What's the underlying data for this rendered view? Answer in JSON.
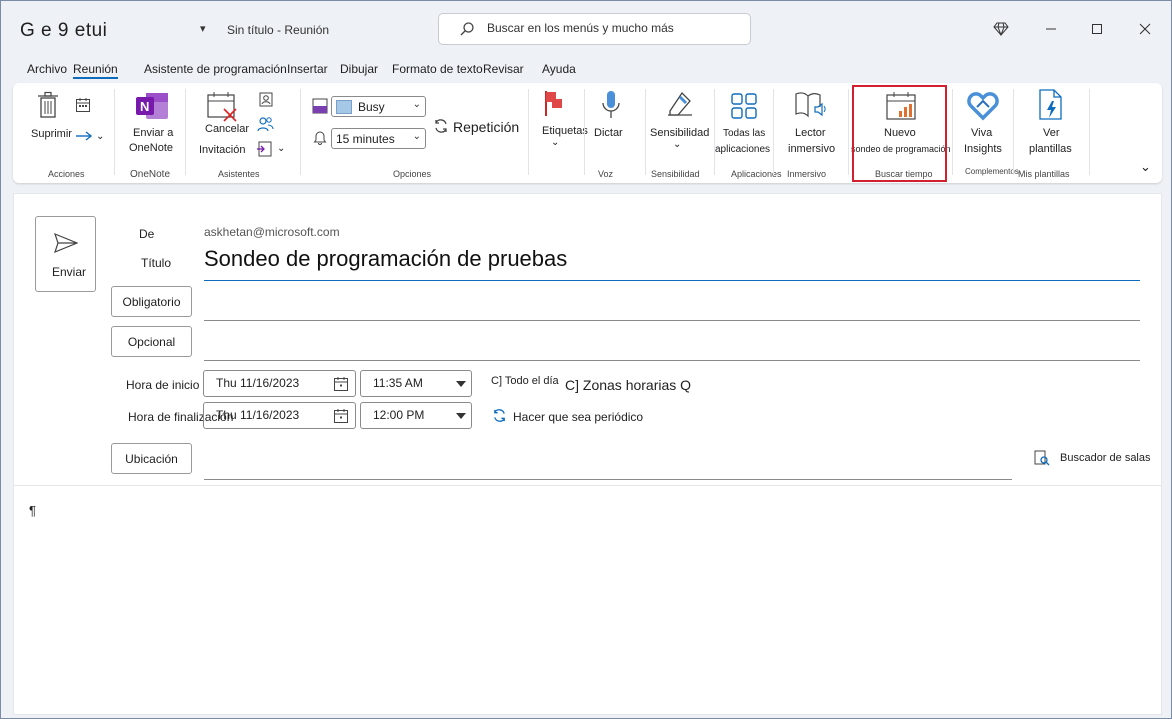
{
  "title_bar": {
    "app_title": "G e 9 etui",
    "quick_access_arrow": "▾",
    "doc_title": "Sin título  -  Reunión",
    "search_placeholder": "Buscar en los menús y mucho más"
  },
  "tabs": [
    {
      "label": "Archivo",
      "active": false
    },
    {
      "label": "Reunión",
      "active": true
    },
    {
      "label": "Asistente de programación",
      "active": false
    },
    {
      "label": "Insertar",
      "active": false
    },
    {
      "label": "Dibujar",
      "active": false
    },
    {
      "label": "Formato de texto",
      "active": false
    },
    {
      "label": "Revisar",
      "active": false
    },
    {
      "label": "Ayuda",
      "active": false
    }
  ],
  "ribbon": {
    "acciones": {
      "delete_label": "Suprimir",
      "group": "Acciones"
    },
    "onenote": {
      "line1": "Enviar a",
      "line2": "OneNote",
      "group": "OneNote"
    },
    "asistentes": {
      "cancel_label": "Cancelar",
      "invite_label": "Invitación",
      "group": "Asistentes"
    },
    "opciones": {
      "show_as": "Busy",
      "reminder": "15 minutes",
      "recurrence": "Repetición",
      "group": "Opciones"
    },
    "etiquetas": {
      "label": "Etiquetas"
    },
    "voz": {
      "label": "Dictar",
      "group": "Voz"
    },
    "sensibilidad": {
      "label": "Sensibilidad",
      "group": "Sensibilidad"
    },
    "aplicaciones": {
      "line1": "Todas las",
      "line2": "aplicaciones",
      "group": "Aplicaciones"
    },
    "inmersivo": {
      "line1": "Lector",
      "line2": "inmersivo",
      "group": "Inmersivo"
    },
    "buscar_tiempo": {
      "line1": "Nuevo",
      "line2": "sondeo de programación",
      "group": "Buscar tiempo"
    },
    "complementos": {
      "line1": "Viva",
      "line2": "Insights",
      "group": "Complementos"
    },
    "plantillas": {
      "line1": "Ver",
      "line2": "plantillas",
      "group": "Mis plantillas"
    }
  },
  "form": {
    "send_label": "Enviar",
    "from_label": "De",
    "from_value": "askhetan@microsoft.com",
    "title_label": "Título",
    "title_value": "Sondeo de programación de pruebas",
    "required_button": "Obligatorio",
    "optional_button": "Opcional",
    "start_label": "Hora de inicio",
    "start_date": "Thu 11/16/2023",
    "start_time": "11:35 AM",
    "allday_label": "C] Todo el día",
    "timezones_label": "C] Zonas horarias Q",
    "end_label": "Hora de finalización",
    "end_date": "Thu 11/16/2023",
    "end_time": "12:00 PM",
    "recurring_label": "Hacer que sea periódico",
    "location_button": "Ubicación",
    "room_finder_label": "Buscador de salas",
    "body_mark": "¶"
  },
  "colors": {
    "accent": "#0f6cbd",
    "highlight": "#d22030",
    "onenote": "#7719aa",
    "tag_red": "#e04848"
  }
}
